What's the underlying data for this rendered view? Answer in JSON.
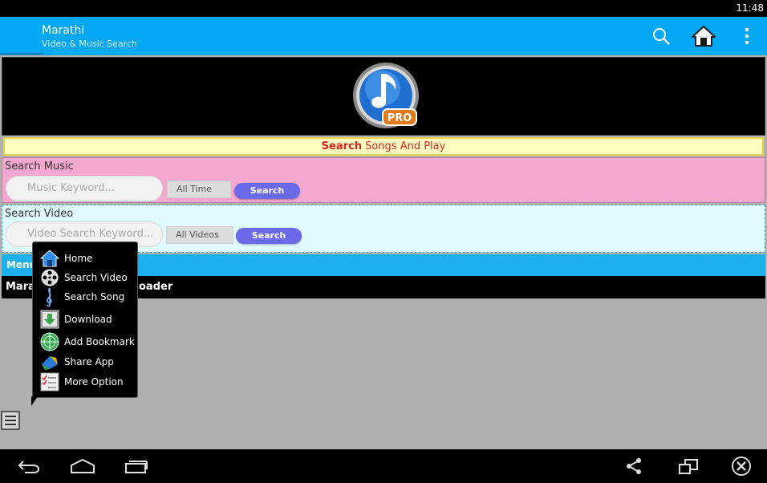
{
  "status_bar": {
    "time": "11:48"
  },
  "action_bar": {
    "title": "Marathi",
    "subtitle": "Video & Music Search",
    "icons": [
      "search-icon",
      "home-icon",
      "overflow-menu-icon"
    ]
  },
  "logo": {
    "badge": "PRO"
  },
  "tagline": {
    "bold": "Search",
    "rest": " Songs And Play"
  },
  "music_search": {
    "label": "Search Music",
    "placeholder": "Music Keyword...",
    "filter": "All Time",
    "button": "Search"
  },
  "video_search": {
    "label": "Search Video",
    "placeholder": "Video Search Keyword...",
    "filter": "All Videos",
    "button": "Search"
  },
  "menu_bar": {
    "label": "Menu"
  },
  "app_bar": {
    "label_start": "Marat",
    "label_end": "oader"
  },
  "popup_menu": {
    "items": [
      {
        "label": "Home",
        "icon": "home-icon"
      },
      {
        "label": "Search Video",
        "icon": "film-reel-icon"
      },
      {
        "label": "Search Song",
        "icon": "music-clef-icon"
      },
      {
        "label": "Download",
        "icon": "download-icon"
      },
      {
        "label": "Add Bookmark",
        "icon": "bookmark-globe-icon"
      },
      {
        "label": "Share App",
        "icon": "share-icon"
      },
      {
        "label": "More Option",
        "icon": "checklist-icon"
      }
    ]
  },
  "nav_bar": {
    "icons": [
      "back-icon",
      "home-outline-icon",
      "recent-apps-icon",
      "share-nodes-icon",
      "window-resize-icon",
      "close-circle-icon"
    ]
  },
  "colors": {
    "action_bar": "#03a9f4",
    "music_panel": "#f4a8d0",
    "video_panel": "#dffaff",
    "search_button": "#6a6ae8",
    "tagline_text": "#dd2222"
  }
}
